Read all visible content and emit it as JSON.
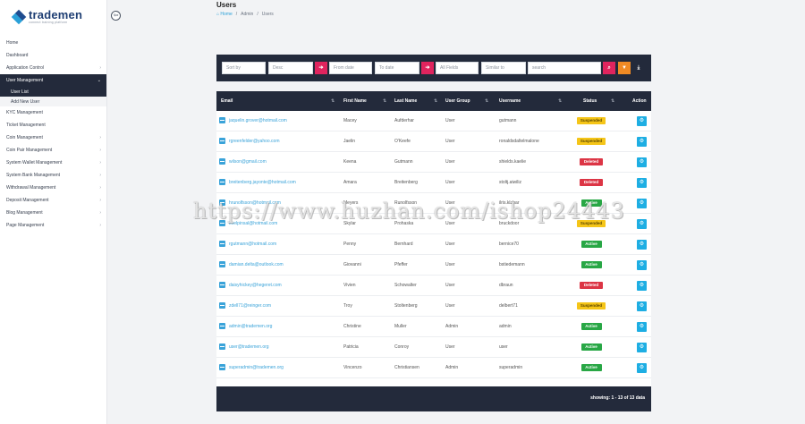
{
  "brand": {
    "name": "trademen",
    "tagline": "connect training platform"
  },
  "sidebar": {
    "items": [
      {
        "label": "Home",
        "chevron": false
      },
      {
        "label": "Dashboard",
        "chevron": false
      },
      {
        "label": "Application Control",
        "chevron": true
      },
      {
        "label": "User Management",
        "chevron": true,
        "active": true
      },
      {
        "label": "KYC Management",
        "chevron": false
      },
      {
        "label": "Ticket Management",
        "chevron": false
      },
      {
        "label": "Coin Management",
        "chevron": true
      },
      {
        "label": "Coin Pair Management",
        "chevron": true
      },
      {
        "label": "System Wallet Management",
        "chevron": true
      },
      {
        "label": "System Bank Management",
        "chevron": true
      },
      {
        "label": "Withdrawal Management",
        "chevron": true
      },
      {
        "label": "Deposit Management",
        "chevron": true
      },
      {
        "label": "Blog Management",
        "chevron": true
      },
      {
        "label": "Page Management",
        "chevron": true
      }
    ],
    "subitems": [
      {
        "label": "User List"
      },
      {
        "label": "Add New User"
      }
    ]
  },
  "header": {
    "title": "Users",
    "breadcrumb": [
      "Home",
      "/",
      "Admin",
      "/",
      "Users"
    ]
  },
  "filters": {
    "sort_by": "Sort by",
    "order": "Desc",
    "from_date": "From date",
    "to_date": "To date",
    "field": "All Fields",
    "operator": "Similar to",
    "search": "search"
  },
  "table": {
    "columns": [
      "Email",
      "First Name",
      "Last Name",
      "User Group",
      "Username",
      "Status",
      "Action"
    ],
    "rows": [
      {
        "email": "jaquelin.grover@hotmail.com",
        "first": "Macey",
        "last": "Aufderhar",
        "group": "User",
        "username": "gutmann",
        "status": "Suspended"
      },
      {
        "email": "rgreenfelder@yahoo.com",
        "first": "Jaelin",
        "last": "O'Keefe",
        "group": "User",
        "username": "ronaldsdaltelmalone",
        "status": "Suspended"
      },
      {
        "email": "wilson@gmail.com",
        "first": "Keena",
        "last": "Gutmann",
        "group": "User",
        "username": "shields.kaelie",
        "status": "Deleted"
      },
      {
        "email": "breitenberg.jayonte@hotmail.com",
        "first": "Amara",
        "last": "Breitenberg",
        "group": "User",
        "username": "stoltj.aiwiliz",
        "status": "Deleted"
      },
      {
        "email": "hrunolfsson@hotmail.com",
        "first": "Meyers",
        "last": "Runolfsson",
        "group": "User",
        "username": "ilris.klabar",
        "status": "Active"
      },
      {
        "email": "koelpinsal@hotmail.com",
        "first": "Skylar",
        "last": "Prohaska",
        "group": "User",
        "username": "bruckdoor",
        "status": "Suspended"
      },
      {
        "email": "rgutmann@hotmail.com",
        "first": "Penny",
        "last": "Bernhard",
        "group": "User",
        "username": "bernice70",
        "status": "Active"
      },
      {
        "email": "damian.delta@outlook.com",
        "first": "Giovanni",
        "last": "Pfeffer",
        "group": "User",
        "username": "bstiedemann",
        "status": "Active"
      },
      {
        "email": "daisyhickey@hegeret.com",
        "first": "Vivien",
        "last": "Schowalter",
        "group": "User",
        "username": "dbraun",
        "status": "Deleted"
      },
      {
        "email": "zdell71@reinger.com",
        "first": "Troy",
        "last": "Stoltenberg",
        "group": "User",
        "username": "delbert71",
        "status": "Suspended"
      },
      {
        "email": "admin@trademen.org",
        "first": "Christine",
        "last": "Muller",
        "group": "Admin",
        "username": "admin",
        "status": "Active"
      },
      {
        "email": "user@trademen.org",
        "first": "Patricia",
        "last": "Conroy",
        "group": "User",
        "username": "user",
        "status": "Active"
      },
      {
        "email": "superadmin@trademen.org",
        "first": "Vincenzo",
        "last": "Christiansen",
        "group": "Admin",
        "username": "superadmin",
        "status": "Active"
      }
    ],
    "footer": "showing: 1 - 13 of 13 data"
  },
  "status_colors": {
    "Active": "#28a745",
    "Suspended": "#f5c518",
    "Deleted": "#dc3545"
  },
  "watermark": "https://www.huzhan.com/ishop24443"
}
